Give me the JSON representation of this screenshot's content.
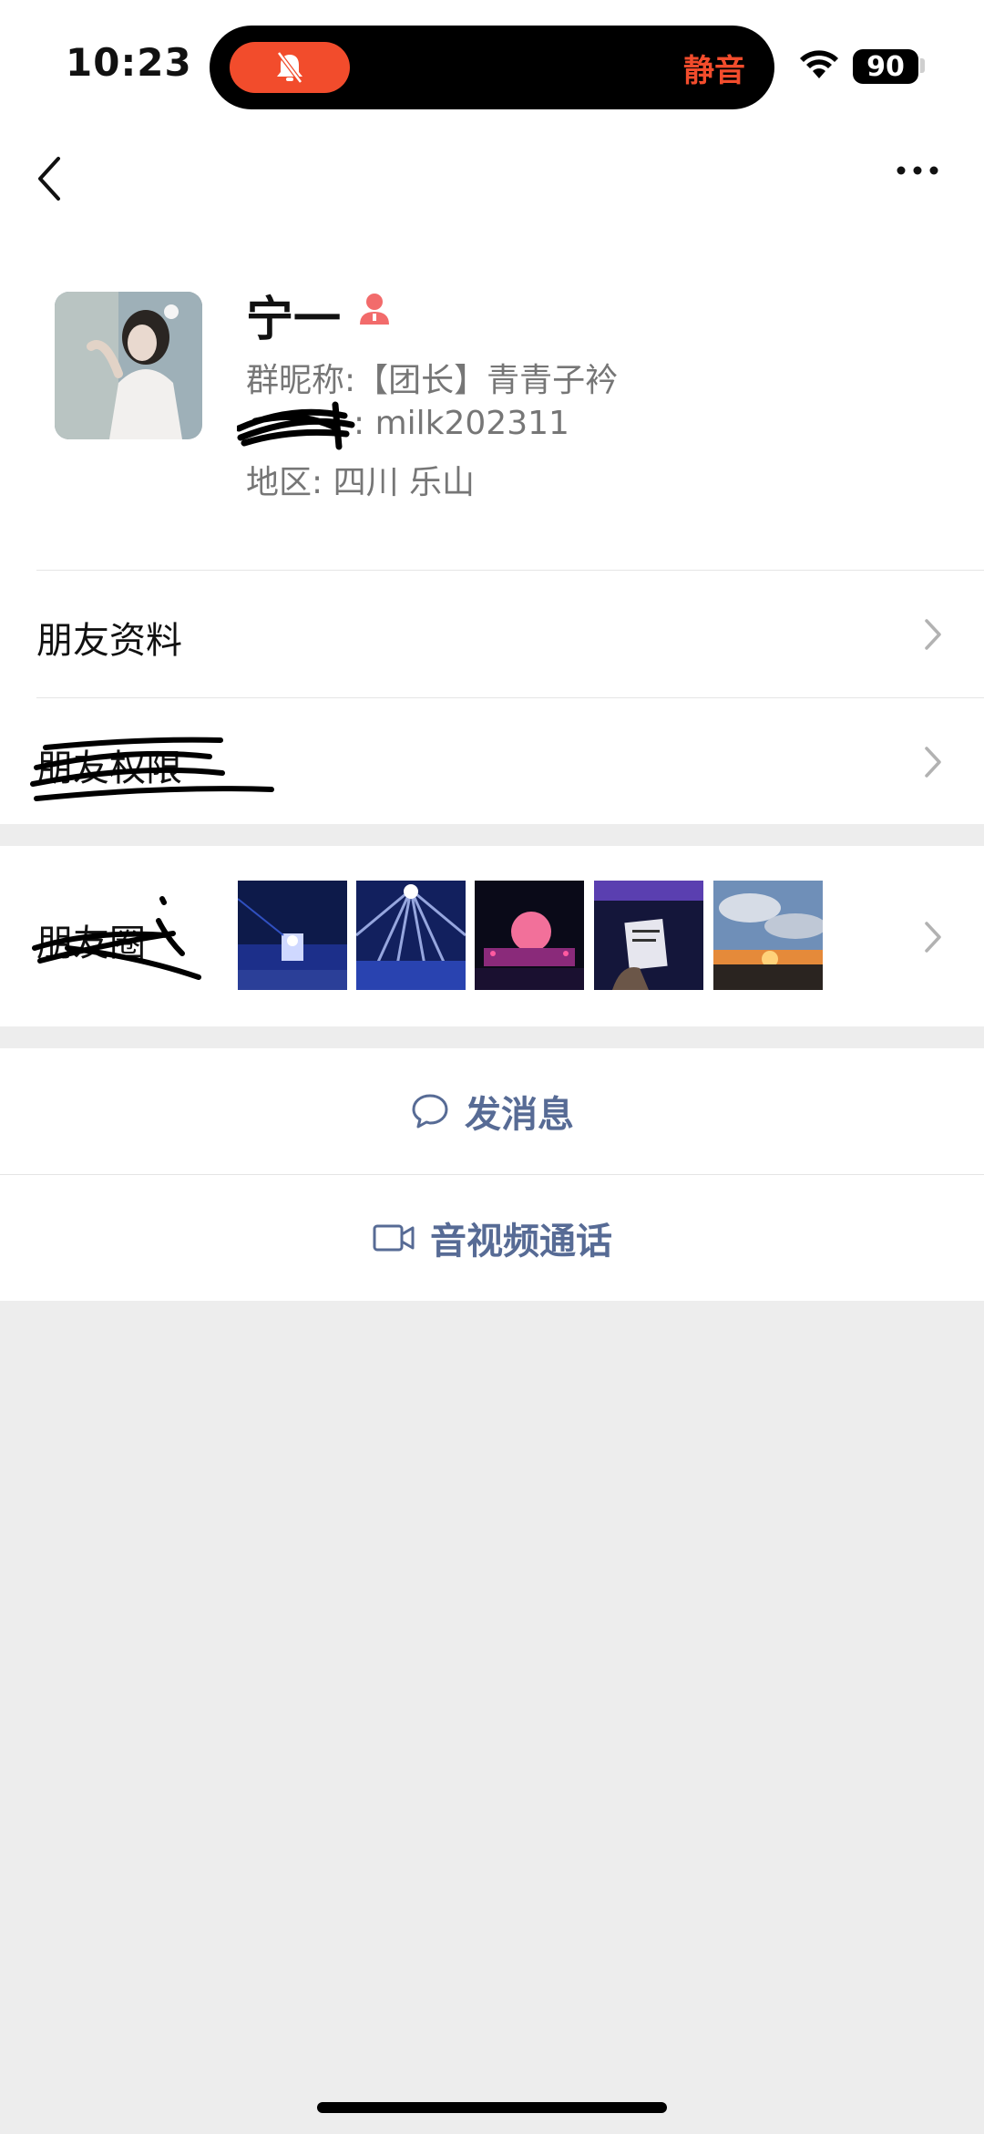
{
  "status_bar": {
    "time": "10:23",
    "silent_label": "静音",
    "battery_level": "90"
  },
  "profile": {
    "name": "宁一",
    "nickname_line": "群昵称:【团长】青青子衿",
    "wechat_id_value": ": milk202311",
    "region_line": "地区: 四川 乐山"
  },
  "rows": {
    "friend_info": "朋友资料",
    "friend_permissions": "朋友权限",
    "moments": "朋友圈"
  },
  "actions": {
    "send_message": "发消息",
    "video_call": "音视频通话"
  },
  "colors": {
    "accent": "#576b95",
    "silent": "#f24c2c",
    "female_icon": "#f26b6b"
  }
}
